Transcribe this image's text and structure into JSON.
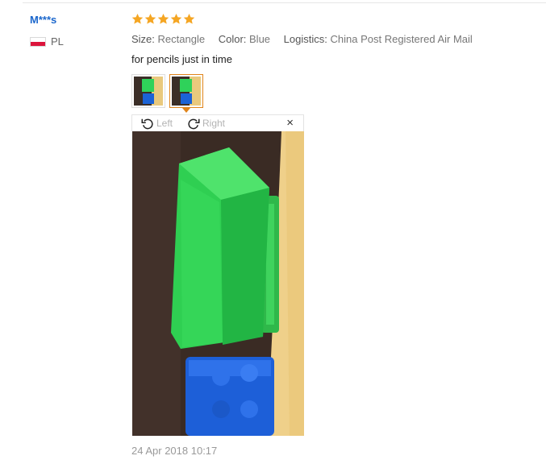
{
  "review": {
    "user": "M***s",
    "country": "PL",
    "rating": 5,
    "attributes": [
      {
        "key": "Size:",
        "value": "Rectangle"
      },
      {
        "key": "Color:",
        "value": "Blue"
      },
      {
        "key": "Logistics:",
        "value": "China Post Registered Air Mail"
      }
    ],
    "text": "for pencils just in time",
    "date": "24 Apr 2018 10:17"
  },
  "viewer": {
    "rotate_left": "Left",
    "rotate_right": "Right",
    "close": "×"
  },
  "colors": {
    "link": "#1a66cc",
    "star": "#f5a623",
    "active_thumb": "#e0841a"
  }
}
